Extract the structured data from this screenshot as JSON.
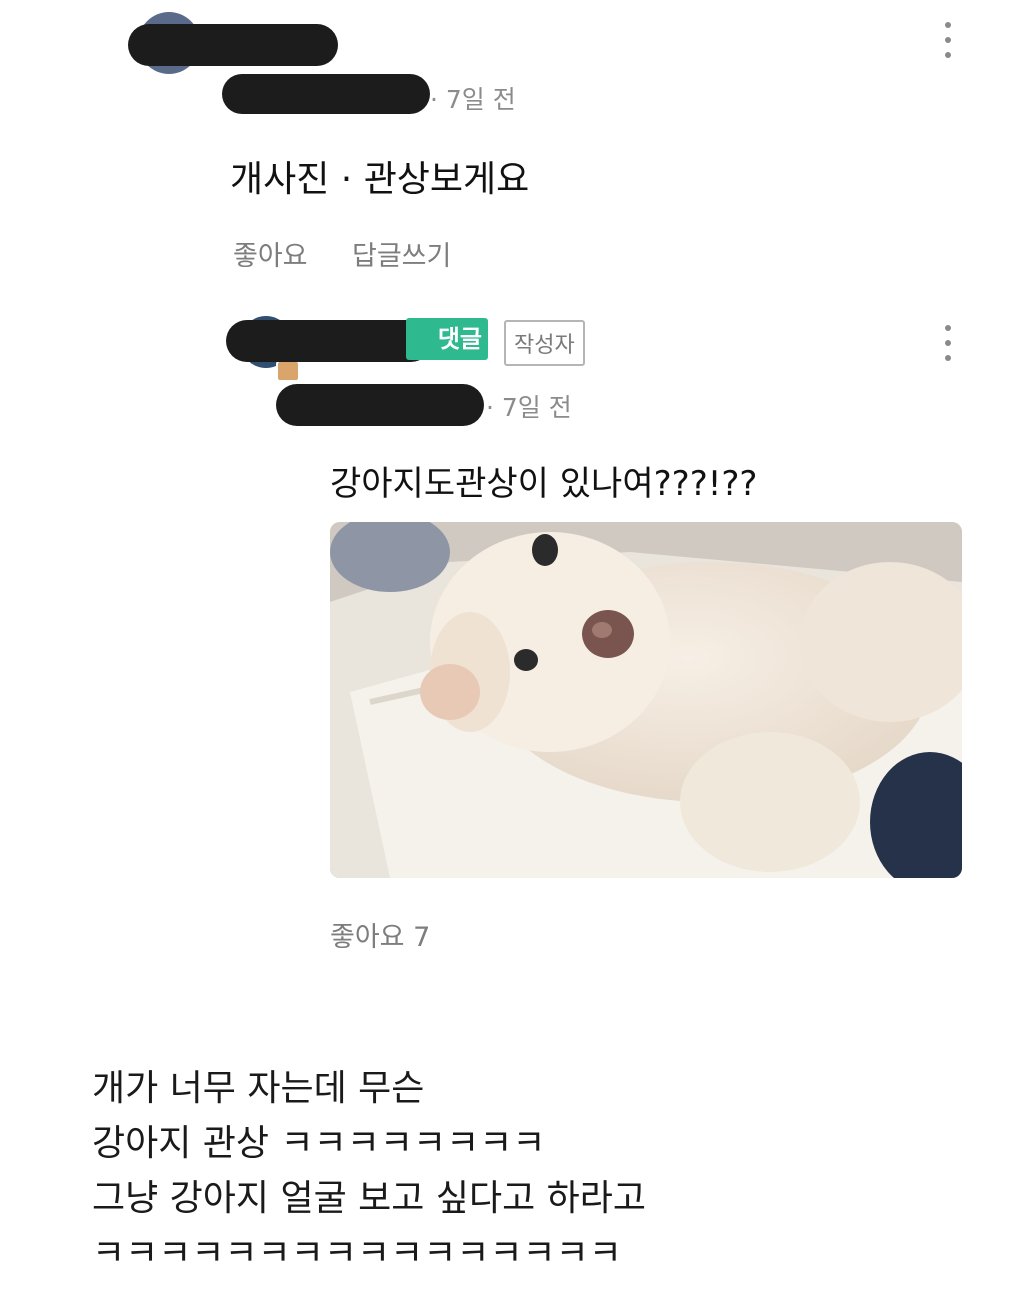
{
  "comment": {
    "time": "· 7일 전",
    "text": "개사진 · 관상보게요",
    "like_label": "좋아요",
    "reply_label": "답글쓰기"
  },
  "reply": {
    "best_badge": "댓글",
    "author_badge": "작성자",
    "time": "· 7일 전",
    "text": "강아지도관상이 있나여???!??",
    "likes": "좋아요 7"
  },
  "caption": {
    "lines": [
      "개가 너무 자는데 무슨",
      "강아지 관상 ㅋㅋㅋㅋㅋㅋㅋㅋ",
      "그냥 강아지 얼굴 보고 싶다고 하라고",
      "ㅋㅋㅋㅋㅋㅋㅋㅋㅋㅋㅋㅋㅋㅋㅋㅋ"
    ]
  },
  "icons": {
    "more": "more-vertical-icon",
    "badge": "level-badge-icon"
  },
  "colors": {
    "best_badge": "#2fb98f",
    "meta_text": "#8b8b8b"
  }
}
